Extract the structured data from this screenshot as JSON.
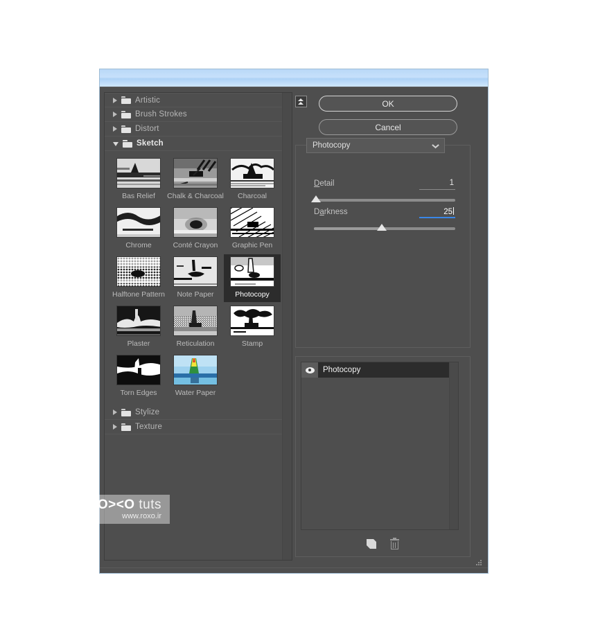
{
  "window": {
    "title": "",
    "titlebar_color": "#c6e0fb",
    "body_color": "#4e4e4e"
  },
  "filter_browser": {
    "categories": [
      {
        "label": "Artistic",
        "expanded": false
      },
      {
        "label": "Brush Strokes",
        "expanded": false
      },
      {
        "label": "Distort",
        "expanded": false
      },
      {
        "label": "Sketch",
        "expanded": true
      },
      {
        "label": "Stylize",
        "expanded": false
      },
      {
        "label": "Texture",
        "expanded": false
      }
    ],
    "sketch_filters": [
      {
        "label": "Bas Relief",
        "selected": false
      },
      {
        "label": "Chalk & Charcoal",
        "selected": false
      },
      {
        "label": "Charcoal",
        "selected": false
      },
      {
        "label": "Chrome",
        "selected": false
      },
      {
        "label": "Conté Crayon",
        "selected": false
      },
      {
        "label": "Graphic Pen",
        "selected": false
      },
      {
        "label": "Halftone Pattern",
        "selected": false
      },
      {
        "label": "Note Paper",
        "selected": false
      },
      {
        "label": "Photocopy",
        "selected": true
      },
      {
        "label": "Plaster",
        "selected": false
      },
      {
        "label": "Reticulation",
        "selected": false
      },
      {
        "label": "Stamp",
        "selected": false
      },
      {
        "label": "Torn Edges",
        "selected": false
      },
      {
        "label": "Water Paper",
        "selected": false
      }
    ]
  },
  "buttons": {
    "ok": "OK",
    "cancel": "Cancel",
    "collapse_icon": "double-chevron-up-icon"
  },
  "settings": {
    "filter_select_value": "Photocopy",
    "params": [
      {
        "label_pre": "D",
        "label_accel": "",
        "label_rest": "etail",
        "label_full": "Detail",
        "value": "1",
        "focused": false,
        "knob_percent": 2,
        "fill_percent": 2
      },
      {
        "label_pre": "D",
        "label_accel": "a",
        "label_rest": "rkness",
        "label_full": "Darkness",
        "value": "25",
        "focused": true,
        "knob_percent": 48,
        "fill_percent": 48
      }
    ],
    "focus_color": "#3a87e8"
  },
  "effect_layers": {
    "rows": [
      {
        "name": "Photocopy",
        "visible": true,
        "selected": true
      }
    ],
    "tools": [
      {
        "name": "new-effect-layer-icon"
      },
      {
        "name": "delete-effect-layer-icon"
      }
    ]
  },
  "watermark": {
    "brand_bold": "RO><O",
    "brand_soft": " tuts",
    "url": "www.roxo.ir"
  }
}
